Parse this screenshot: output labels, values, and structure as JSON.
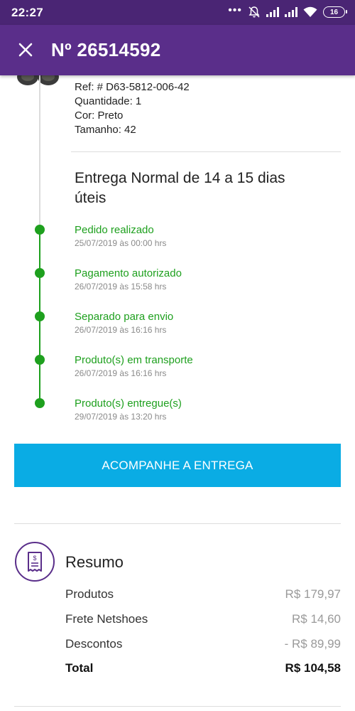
{
  "status_bar": {
    "time": "22:27",
    "battery": "16",
    "icons": [
      "more-dots-icon",
      "muted-bell-icon",
      "signal-icon",
      "signal-icon",
      "wifi-icon",
      "battery-icon"
    ]
  },
  "header": {
    "title": "Nº 26514592",
    "close_icon": "close-icon"
  },
  "product": {
    "ref": "Ref: # D63-5812-006-42",
    "quantity": "Quantidade: 1",
    "color": "Cor: Preto",
    "size": "Tamanho: 42"
  },
  "delivery": {
    "title": "Entrega Normal de 14 a 15 dias úteis",
    "steps": [
      {
        "label": "Pedido realizado",
        "date": "25/07/2019 às 00:00 hrs"
      },
      {
        "label": "Pagamento autorizado",
        "date": "26/07/2019 às 15:58 hrs"
      },
      {
        "label": "Separado para envio",
        "date": "26/07/2019 às 16:16 hrs"
      },
      {
        "label": "Produto(s) em transporte",
        "date": "26/07/2019 às 16:16 hrs"
      },
      {
        "label": "Produto(s) entregue(s)",
        "date": "29/07/2019 às 13:20 hrs"
      }
    ],
    "button_label": "ACOMPANHE A ENTREGA"
  },
  "summary": {
    "title": "Resumo",
    "icon": "receipt-icon",
    "rows": [
      {
        "label": "Produtos",
        "value": "R$ 179,97"
      },
      {
        "label": "Frete Netshoes",
        "value": "R$ 14,60"
      },
      {
        "label": "Descontos",
        "value": "- R$ 89,99"
      }
    ],
    "total": {
      "label": "Total",
      "value": "R$ 104,58"
    }
  },
  "colors": {
    "status_bar": "#4a2574",
    "app_bar": "#5a2e8a",
    "step_green": "#1ea01e",
    "button_blue": "#0aace4"
  }
}
